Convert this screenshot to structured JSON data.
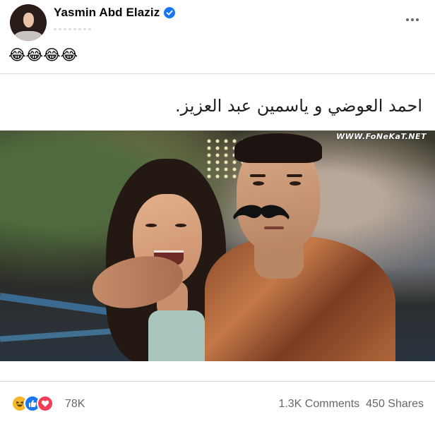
{
  "post": {
    "author_name": "Yasmin Abd Elaziz",
    "verified": true,
    "caption_emojis": [
      "😂",
      "😂",
      "😂",
      "😂"
    ],
    "more_icon": "more-horizontal-icon"
  },
  "shared_content": {
    "title": "احمد العوضي و ياسمين عبد العزيز.",
    "watermark": "WWW.FoNeKaT.NET"
  },
  "footer": {
    "reaction_icons": [
      "haha-icon",
      "like-icon",
      "love-icon"
    ],
    "reaction_count": "78K",
    "comments": "1.3K Comments",
    "shares": "450 Shares"
  },
  "colors": {
    "verified_blue": "#1877f2",
    "like_blue": "#1877f2",
    "love_red": "#f33e58",
    "haha_yellow": "#f7b928",
    "secondary_text": "#65676b"
  }
}
